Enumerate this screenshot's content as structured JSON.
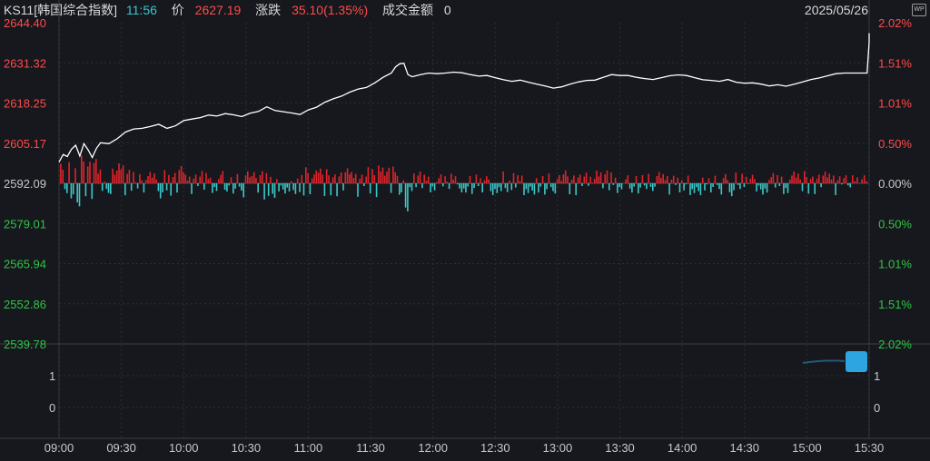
{
  "header": {
    "code": "KS11[韩国综合指数]",
    "time": "11:56",
    "price_label": "价",
    "price": "2627.19",
    "change_label": "涨跌",
    "change": "35.10(1.35%)",
    "volume_label": "成交金额",
    "volume": "0",
    "date": "2025/05/26",
    "wp_icon": "WP"
  },
  "colors": {
    "background": "#16181d",
    "price_line": "#ffffff",
    "up": "#e0232b",
    "down": "#3cc8c8",
    "grid": "#2b2f36",
    "up_text": "#ff4a4a",
    "down_text": "#2fc545",
    "neutral_text": "#c8c8c8"
  },
  "chart_data": {
    "type": "line",
    "title": "",
    "ylim": [
      2539.78,
      2644.4
    ],
    "base": 2592.09,
    "y_ticks_left": [
      "2644.40",
      "2631.32",
      "2618.25",
      "2605.17",
      "2592.09",
      "2579.01",
      "2565.94",
      "2552.86",
      "2539.78"
    ],
    "y_ticks_right": [
      "2.02%",
      "1.51%",
      "1.01%",
      "0.50%",
      "0.00%",
      "0.50%",
      "1.01%",
      "1.51%",
      "2.02%"
    ],
    "x_ticks": [
      "09:00",
      "09:30",
      "10:00",
      "10:30",
      "11:00",
      "11:30",
      "12:00",
      "12:30",
      "13:00",
      "13:30",
      "14:00",
      "14:30",
      "15:00",
      "15:30"
    ],
    "x_range": [
      "09:00",
      "15:30"
    ],
    "series": [
      {
        "values": [
          [
            "09:00",
            2599.0
          ],
          [
            "09:02",
            2601.5
          ],
          [
            "09:04",
            2600.8
          ],
          [
            "09:06",
            2603.2
          ],
          [
            "09:08",
            2604.5
          ],
          [
            "09:10",
            2601.0
          ],
          [
            "09:12",
            2605.0
          ],
          [
            "09:14",
            2603.0
          ],
          [
            "09:16",
            2600.5
          ],
          [
            "09:18",
            2603.5
          ],
          [
            "09:20",
            2605.3
          ],
          [
            "09:24",
            2605.0
          ],
          [
            "09:28",
            2606.6
          ],
          [
            "09:32",
            2608.8
          ],
          [
            "09:36",
            2609.8
          ],
          [
            "09:40",
            2610.0
          ],
          [
            "09:44",
            2610.6
          ],
          [
            "09:48",
            2611.3
          ],
          [
            "09:52",
            2610.0
          ],
          [
            "09:56",
            2610.8
          ],
          [
            "10:00",
            2612.5
          ],
          [
            "10:04",
            2613.0
          ],
          [
            "10:08",
            2613.5
          ],
          [
            "10:12",
            2614.3
          ],
          [
            "10:16",
            2614.0
          ],
          [
            "10:20",
            2614.8
          ],
          [
            "10:24",
            2614.4
          ],
          [
            "10:28",
            2613.8
          ],
          [
            "10:32",
            2614.9
          ],
          [
            "10:36",
            2615.5
          ],
          [
            "10:40",
            2617.0
          ],
          [
            "10:44",
            2615.8
          ],
          [
            "10:48",
            2615.4
          ],
          [
            "10:52",
            2615.0
          ],
          [
            "10:56",
            2614.5
          ],
          [
            "11:00",
            2616.0
          ],
          [
            "11:04",
            2616.9
          ],
          [
            "11:08",
            2618.5
          ],
          [
            "11:12",
            2619.6
          ],
          [
            "11:16",
            2620.5
          ],
          [
            "11:20",
            2621.8
          ],
          [
            "11:24",
            2622.8
          ],
          [
            "11:28",
            2623.3
          ],
          [
            "11:32",
            2624.8
          ],
          [
            "11:36",
            2626.6
          ],
          [
            "11:40",
            2628.0
          ],
          [
            "11:42",
            2630.0
          ],
          [
            "11:44",
            2631.0
          ],
          [
            "11:46",
            2631.2
          ],
          [
            "11:48",
            2627.5
          ],
          [
            "11:50",
            2626.8
          ],
          [
            "11:54",
            2627.5
          ],
          [
            "11:58",
            2628.0
          ],
          [
            "12:02",
            2627.8
          ],
          [
            "12:06",
            2628.0
          ],
          [
            "12:10",
            2628.3
          ],
          [
            "12:14",
            2628.1
          ],
          [
            "12:18",
            2627.5
          ],
          [
            "12:22",
            2627.0
          ],
          [
            "12:26",
            2627.2
          ],
          [
            "12:30",
            2626.5
          ],
          [
            "12:34",
            2625.8
          ],
          [
            "12:38",
            2625.3
          ],
          [
            "12:42",
            2625.7
          ],
          [
            "12:46",
            2625.0
          ],
          [
            "12:50",
            2624.4
          ],
          [
            "12:54",
            2623.8
          ],
          [
            "12:58",
            2623.1
          ],
          [
            "13:02",
            2623.5
          ],
          [
            "13:06",
            2624.4
          ],
          [
            "13:10",
            2625.1
          ],
          [
            "13:14",
            2625.6
          ],
          [
            "13:18",
            2625.7
          ],
          [
            "13:22",
            2626.6
          ],
          [
            "13:26",
            2627.5
          ],
          [
            "13:30",
            2627.2
          ],
          [
            "13:34",
            2627.2
          ],
          [
            "13:38",
            2626.6
          ],
          [
            "13:42",
            2626.2
          ],
          [
            "13:46",
            2625.9
          ],
          [
            "13:50",
            2626.5
          ],
          [
            "13:54",
            2627.1
          ],
          [
            "13:58",
            2627.4
          ],
          [
            "14:02",
            2627.2
          ],
          [
            "14:06",
            2626.5
          ],
          [
            "14:10",
            2625.8
          ],
          [
            "14:14",
            2625.6
          ],
          [
            "14:18",
            2625.3
          ],
          [
            "14:22",
            2625.9
          ],
          [
            "14:26",
            2625.0
          ],
          [
            "14:30",
            2624.7
          ],
          [
            "14:34",
            2624.8
          ],
          [
            "14:38",
            2624.4
          ],
          [
            "14:42",
            2623.8
          ],
          [
            "14:46",
            2624.2
          ],
          [
            "14:50",
            2623.7
          ],
          [
            "14:54",
            2624.4
          ],
          [
            "14:58",
            2625.1
          ],
          [
            "15:02",
            2625.9
          ],
          [
            "15:06",
            2626.4
          ],
          [
            "15:10",
            2627.1
          ],
          [
            "15:14",
            2627.8
          ],
          [
            "15:18",
            2628.0
          ],
          [
            "15:20",
            2628.0
          ],
          [
            "15:29",
            2628.0
          ],
          [
            "15:30",
            2638.0
          ],
          [
            "15:30",
            2641.0
          ]
        ]
      }
    ],
    "volume_panel": {
      "y_ticks_left": [
        "1",
        "1",
        "0"
      ],
      "y_ticks_right": [
        "1",
        "1",
        "0"
      ]
    }
  }
}
